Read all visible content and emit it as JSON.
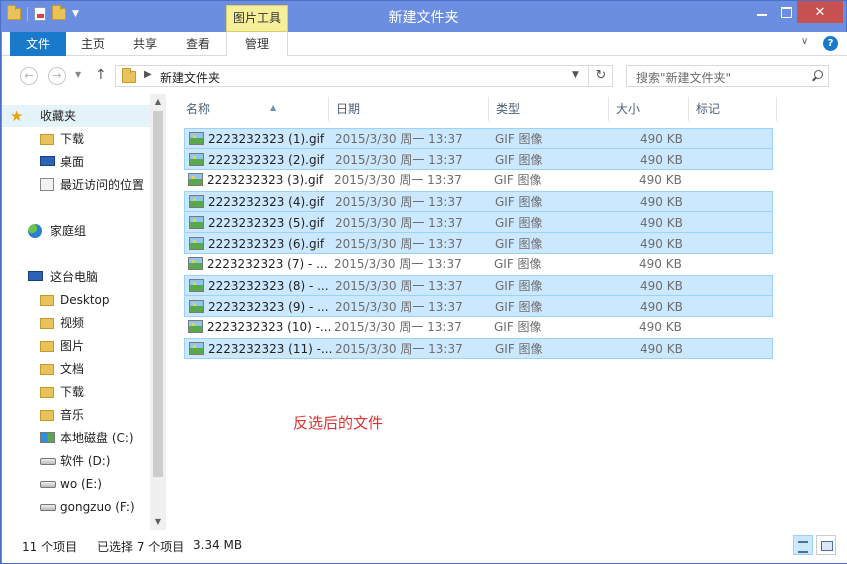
{
  "window": {
    "title": "新建文件夹",
    "context_tab": "图片工具"
  },
  "ribbon": {
    "tabs": [
      {
        "label": "文件",
        "kind": "file"
      },
      {
        "label": "主页"
      },
      {
        "label": "共享"
      },
      {
        "label": "查看"
      },
      {
        "label": "管理",
        "active": true
      }
    ]
  },
  "address": {
    "path": "新建文件夹",
    "search_placeholder": "搜索\"新建文件夹\""
  },
  "nav": {
    "items": [
      {
        "label": "收藏夹",
        "icon": "star-icon"
      },
      {
        "label": "下载",
        "icon": "download-folder-icon"
      },
      {
        "label": "桌面",
        "icon": "desktop-icon"
      },
      {
        "label": "最近访问的位置",
        "icon": "recent-places-icon"
      },
      {
        "label": "家庭组",
        "icon": "homegroup-icon"
      },
      {
        "label": "这台电脑",
        "icon": "computer-icon"
      },
      {
        "label": "Desktop",
        "icon": "folder-icon"
      },
      {
        "label": "视频",
        "icon": "videos-folder-icon"
      },
      {
        "label": "图片",
        "icon": "pictures-folder-icon"
      },
      {
        "label": "文档",
        "icon": "documents-folder-icon"
      },
      {
        "label": "下载",
        "icon": "download-folder-icon"
      },
      {
        "label": "音乐",
        "icon": "music-folder-icon"
      },
      {
        "label": "本地磁盘 (C:)",
        "icon": "system-drive-icon"
      },
      {
        "label": "软件 (D:)",
        "icon": "drive-icon"
      },
      {
        "label": "wo (E:)",
        "icon": "drive-icon"
      },
      {
        "label": "gongzuo (F:)",
        "icon": "drive-icon"
      }
    ]
  },
  "columns": [
    "名称",
    "日期",
    "类型",
    "大小",
    "标记"
  ],
  "files": [
    {
      "name": "2223232323 (1).gif",
      "date": "2015/3/30 周一 13:37",
      "type": "GIF 图像",
      "size": "490 KB",
      "selected": true
    },
    {
      "name": "2223232323 (2).gif",
      "date": "2015/3/30 周一 13:37",
      "type": "GIF 图像",
      "size": "490 KB",
      "selected": true
    },
    {
      "name": "2223232323 (3).gif",
      "date": "2015/3/30 周一 13:37",
      "type": "GIF 图像",
      "size": "490 KB",
      "selected": false
    },
    {
      "name": "2223232323 (4).gif",
      "date": "2015/3/30 周一 13:37",
      "type": "GIF 图像",
      "size": "490 KB",
      "selected": true
    },
    {
      "name": "2223232323 (5).gif",
      "date": "2015/3/30 周一 13:37",
      "type": "GIF 图像",
      "size": "490 KB",
      "selected": true
    },
    {
      "name": "2223232323 (6).gif",
      "date": "2015/3/30 周一 13:37",
      "type": "GIF 图像",
      "size": "490 KB",
      "selected": true
    },
    {
      "name": "2223232323 (7) - ...",
      "date": "2015/3/30 周一 13:37",
      "type": "GIF 图像",
      "size": "490 KB",
      "selected": false
    },
    {
      "name": "2223232323 (8) - ...",
      "date": "2015/3/30 周一 13:37",
      "type": "GIF 图像",
      "size": "490 KB",
      "selected": true
    },
    {
      "name": "2223232323 (9) - ...",
      "date": "2015/3/30 周一 13:37",
      "type": "GIF 图像",
      "size": "490 KB",
      "selected": true
    },
    {
      "name": "2223232323 (10) -...",
      "date": "2015/3/30 周一 13:37",
      "type": "GIF 图像",
      "size": "490 KB",
      "selected": false
    },
    {
      "name": "2223232323 (11) -...",
      "date": "2015/3/30 周一 13:37",
      "type": "GIF 图像",
      "size": "490 KB",
      "selected": true
    }
  ],
  "annotation": "反选后的文件",
  "status": {
    "count": "11 个项目",
    "selected": "已选择 7 个项目",
    "size": "3.34 MB"
  },
  "colors": {
    "accent": "#1979ca",
    "titlebar": "#6b8ee0",
    "selection": "#cce8ff",
    "annotation": "#e03030"
  }
}
